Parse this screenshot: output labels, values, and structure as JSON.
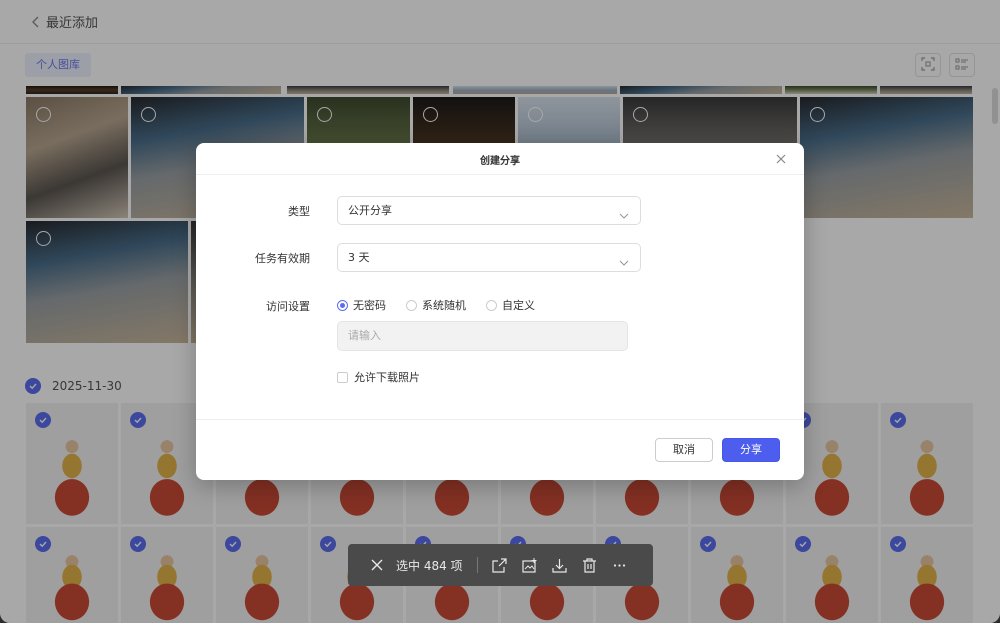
{
  "header": {
    "title": "最近添加"
  },
  "toolbar": {
    "library_tab": "个人图库"
  },
  "date_group": {
    "date": "2025-11-30"
  },
  "action_bar": {
    "selected_text": "选中 484 项"
  },
  "dialog": {
    "title": "创建分享",
    "type_label": "类型",
    "type_value": "公开分享",
    "expiry_label": "任务有效期",
    "expiry_value": "3 天",
    "access_label": "访问设置",
    "access_options": [
      "无密码",
      "系统随机",
      "自定义"
    ],
    "access_selected": "无密码",
    "password_placeholder": "请输入",
    "allow_download_label": "允许下载照片",
    "allow_download_checked": false,
    "cancel_label": "取消",
    "confirm_label": "分享"
  },
  "colors": {
    "accent": "#5b6cf0",
    "primary_button": "#4d5eef"
  },
  "icons": [
    "back-icon",
    "scan-icon",
    "list-view-icon",
    "close-icon",
    "share-icon",
    "add-to-album-icon",
    "download-icon",
    "delete-icon",
    "more-icon",
    "chevron-down-icon",
    "check-icon"
  ]
}
